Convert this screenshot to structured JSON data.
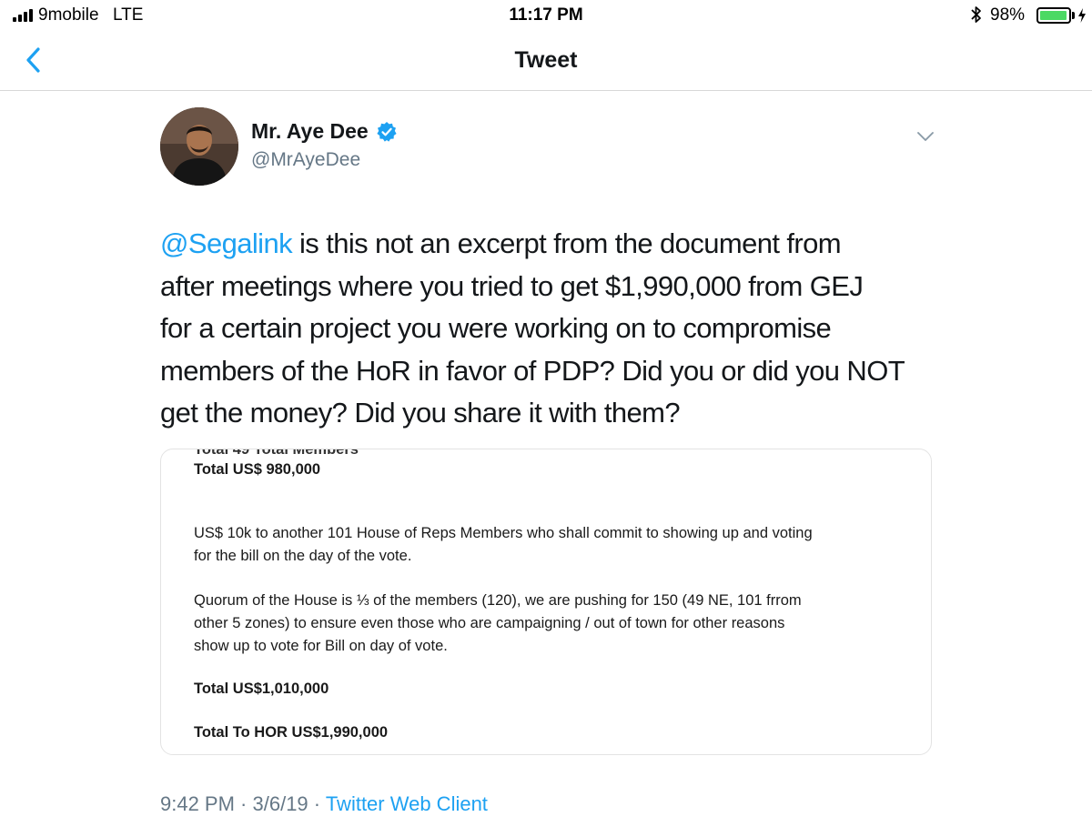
{
  "status_bar": {
    "carrier": "9mobile",
    "network": "LTE",
    "time": "11:17 PM",
    "battery_percent": "98%",
    "battery_level": 0.98,
    "battery_color": "#4cd964"
  },
  "nav": {
    "title": "Tweet",
    "back_icon": "chevron-left-icon"
  },
  "tweet": {
    "display_name": "Mr. Aye Dee",
    "handle": "@MrAyeDee",
    "verified": true,
    "mention": "@Segalink",
    "lines": [
      " is this not an excerpt from the document from",
      "after meetings where you tried to get $1,990,000 from GEJ",
      "for a certain project you were working on to compromise",
      "members of the HoR in favor of PDP? Did you or did you NOT",
      "get the money? Did you share it with them?"
    ],
    "time": "9:42 PM",
    "date": "3/6/19",
    "separator": " · ",
    "client": "Twitter Web Client",
    "accent_color": "#1da1f2"
  },
  "document_image": {
    "cut_line": "Total   49 Total Members",
    "total_1": "Total US$ 980,000",
    "para_1_line_1": "US$ 10k to another 101 House of Reps Members who shall commit to showing up and voting",
    "para_1_line_2": "for the bill on the day of the vote.",
    "para_2_line_1": "Quorum of the House is ⅓ of the members (120), we are pushing for 150 (49 NE, 101 frrom",
    "para_2_line_2": "other 5 zones) to ensure even those who are campaigning / out of town for other reasons",
    "para_2_line_3": "show up to vote for Bill on day of vote.",
    "total_2": "Total US$1,010,000",
    "total_hor": "Total To HOR US$1,990,000"
  }
}
